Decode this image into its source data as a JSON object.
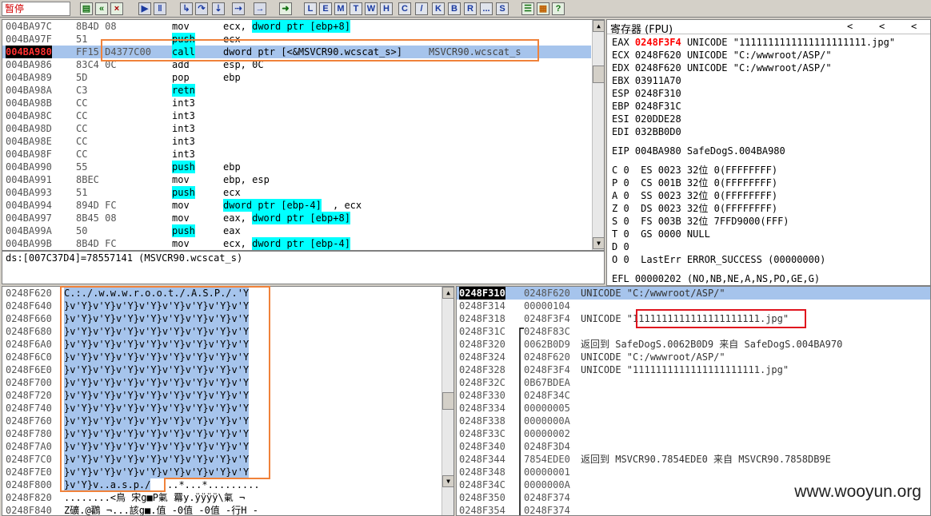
{
  "status": "暂停",
  "toolbar": {
    "buttons": [
      "open-icon",
      "rewind-icon",
      "close-icon",
      "play-icon",
      "pause-icon",
      "step-into-icon",
      "step-over-icon",
      "trace-into-icon",
      "trace-over-icon",
      "execute-till-return-icon",
      "goto-icon"
    ],
    "letters": [
      "L",
      "E",
      "M",
      "T",
      "W",
      "H",
      "C",
      "/",
      "K",
      "B",
      "R",
      "...",
      "S"
    ],
    "tail_buttons": [
      "list-icon",
      "grid-icon",
      "help-icon"
    ]
  },
  "disasm": {
    "rows": [
      {
        "addr": "004BA97C",
        "hex": "8B4D 08",
        "mn": "mov",
        "op": "ecx, ",
        "opc": "dword ptr [ebp+8]",
        "cm": ""
      },
      {
        "addr": "004BA97F",
        "hex": "51",
        "mn": "push",
        "op": "ecx",
        "opc": "",
        "cm": ""
      },
      {
        "addr": "004BA980",
        "hex": "FF15 D4377C00",
        "mn": "call",
        "op": "dword ptr [<&MSVCR90.wcscat_s>]",
        "opc": "",
        "cm": "MSVCR90.wcscat_s"
      },
      {
        "addr": "004BA986",
        "hex": "83C4 0C",
        "mn": "add",
        "op": "esp, 0C",
        "opc": "",
        "cm": ""
      },
      {
        "addr": "004BA989",
        "hex": "5D",
        "mn": "pop",
        "op": "ebp",
        "opc": "",
        "cm": ""
      },
      {
        "addr": "004BA98A",
        "hex": "C3",
        "mn": "retn",
        "op": "",
        "opc": "",
        "cm": ""
      },
      {
        "addr": "004BA98B",
        "hex": "CC",
        "mn": "int3",
        "op": "",
        "opc": "",
        "cm": ""
      },
      {
        "addr": "004BA98C",
        "hex": "CC",
        "mn": "int3",
        "op": "",
        "opc": "",
        "cm": ""
      },
      {
        "addr": "004BA98D",
        "hex": "CC",
        "mn": "int3",
        "op": "",
        "opc": "",
        "cm": ""
      },
      {
        "addr": "004BA98E",
        "hex": "CC",
        "mn": "int3",
        "op": "",
        "opc": "",
        "cm": ""
      },
      {
        "addr": "004BA98F",
        "hex": "CC",
        "mn": "int3",
        "op": "",
        "opc": "",
        "cm": ""
      },
      {
        "addr": "004BA990",
        "hex": "55",
        "mn": "push",
        "op": "ebp",
        "opc": "",
        "cm": ""
      },
      {
        "addr": "004BA991",
        "hex": "8BEC",
        "mn": "mov",
        "op": "ebp, esp",
        "opc": "",
        "cm": ""
      },
      {
        "addr": "004BA993",
        "hex": "51",
        "mn": "push",
        "op": "ecx",
        "opc": "",
        "cm": ""
      },
      {
        "addr": "004BA994",
        "hex": "894D FC",
        "mn": "mov",
        "op": ", ecx",
        "opc": "dword ptr [ebp-4]",
        "cm": "",
        "pre": true
      },
      {
        "addr": "004BA997",
        "hex": "8B45 08",
        "mn": "mov",
        "op": "eax, ",
        "opc": "dword ptr [ebp+8]",
        "cm": ""
      },
      {
        "addr": "004BA99A",
        "hex": "50",
        "mn": "push",
        "op": "eax",
        "opc": "",
        "cm": ""
      },
      {
        "addr": "004BA99B",
        "hex": "8B4D FC",
        "mn": "mov",
        "op": "ecx, ",
        "opc": "dword ptr [ebp-4]",
        "cm": ""
      }
    ],
    "info": "ds:[007C37D4]=78557141 (MSVCR90.wcscat_s)"
  },
  "registers": {
    "title": "寄存器 (FPU)",
    "nav": [
      "<",
      "<",
      "<"
    ],
    "gp": [
      {
        "name": "EAX",
        "val": "0248F3F4",
        "desc": "UNICODE \"1111111111111111111111.jpg\"",
        "hl": true
      },
      {
        "name": "ECX",
        "val": "0248F620",
        "desc": "UNICODE \"C:/wwwroot/ASP/\""
      },
      {
        "name": "EDX",
        "val": "0248F620",
        "desc": "UNICODE \"C:/wwwroot/ASP/\""
      },
      {
        "name": "EBX",
        "val": "03911A70",
        "desc": ""
      },
      {
        "name": "ESP",
        "val": "0248F310",
        "desc": ""
      },
      {
        "name": "EBP",
        "val": "0248F31C",
        "desc": ""
      },
      {
        "name": "ESI",
        "val": "020DDE28",
        "desc": ""
      },
      {
        "name": "EDI",
        "val": "032BB0D0",
        "desc": ""
      }
    ],
    "eip": "EIP 004BA980 SafeDogS.004BA980",
    "flags": [
      "C 0  ES 0023 32位 0(FFFFFFFF)",
      "P 0  CS 001B 32位 0(FFFFFFFF)",
      "A 0  SS 0023 32位 0(FFFFFFFF)",
      "Z 0  DS 0023 32位 0(FFFFFFFF)",
      "S 0  FS 003B 32位 7FFD9000(FFF)",
      "T 0  GS 0000 NULL",
      "D 0",
      "O 0  LastErr ERROR_SUCCESS (00000000)"
    ],
    "efl": "EFL 00000202 (NO,NB,NE,A,NS,PO,GE,G)"
  },
  "dump": {
    "rows": [
      {
        "addr": "0248F620",
        "text": "C.:./.w.w.w.r.o.o.t./.A.S.P./.'Y"
      },
      {
        "addr": "0248F640",
        "text": "}v'Y}v'Y}v'Y}v'Y}v'Y}v'Y}v'Y}v'Y"
      },
      {
        "addr": "0248F660",
        "text": "}v'Y}v'Y}v'Y}v'Y}v'Y}v'Y}v'Y}v'Y"
      },
      {
        "addr": "0248F680",
        "text": "}v'Y}v'Y}v'Y}v'Y}v'Y}v'Y}v'Y}v'Y"
      },
      {
        "addr": "0248F6A0",
        "text": "}v'Y}v'Y}v'Y}v'Y}v'Y}v'Y}v'Y}v'Y"
      },
      {
        "addr": "0248F6C0",
        "text": "}v'Y}v'Y}v'Y}v'Y}v'Y}v'Y}v'Y}v'Y"
      },
      {
        "addr": "0248F6E0",
        "text": "}v'Y}v'Y}v'Y}v'Y}v'Y}v'Y}v'Y}v'Y"
      },
      {
        "addr": "0248F700",
        "text": "}v'Y}v'Y}v'Y}v'Y}v'Y}v'Y}v'Y}v'Y"
      },
      {
        "addr": "0248F720",
        "text": "}v'Y}v'Y}v'Y}v'Y}v'Y}v'Y}v'Y}v'Y"
      },
      {
        "addr": "0248F740",
        "text": "}v'Y}v'Y}v'Y}v'Y}v'Y}v'Y}v'Y}v'Y"
      },
      {
        "addr": "0248F760",
        "text": "}v'Y}v'Y}v'Y}v'Y}v'Y}v'Y}v'Y}v'Y"
      },
      {
        "addr": "0248F780",
        "text": "}v'Y}v'Y}v'Y}v'Y}v'Y}v'Y}v'Y}v'Y"
      },
      {
        "addr": "0248F7A0",
        "text": "}v'Y}v'Y}v'Y}v'Y}v'Y}v'Y}v'Y}v'Y"
      },
      {
        "addr": "0248F7C0",
        "text": "}v'Y}v'Y}v'Y}v'Y}v'Y}v'Y}v'Y}v'Y"
      },
      {
        "addr": "0248F7E0",
        "text": "}v'Y}v'Y}v'Y}v'Y}v'Y}v'Y}v'Y}v'Y"
      },
      {
        "addr": "0248F800",
        "text": "}v'Y}v..a.s.p./",
        "text2": "..*...*........."
      },
      {
        "addr": "0248F820",
        "text": "........<鳥 宋g■P氭 羃y.ÿÿÿÿ\\氭 ¬"
      },
      {
        "addr": "0248F840",
        "text": "Z礦.@鸐 ¬...該g■.值 -0值 -0值 -行H -"
      }
    ]
  },
  "stack": {
    "rows": [
      {
        "addr": "0248F310",
        "val": "0248F620",
        "desc": "UNICODE \"C:/wwwroot/ASP/\"",
        "cur": true
      },
      {
        "addr": "0248F314",
        "val": "00000104",
        "desc": ""
      },
      {
        "addr": "0248F318",
        "val": "0248F3F4",
        "desc": "UNICODE \"1111111111111111111111.jpg\""
      },
      {
        "addr": "0248F31C",
        "val": "0248F83C",
        "desc": ""
      },
      {
        "addr": "0248F320",
        "val": "0062B0D9",
        "desc": "返回到 SafeDogS.0062B0D9 来自 SafeDogS.004BA970"
      },
      {
        "addr": "0248F324",
        "val": "0248F620",
        "desc": "UNICODE \"C:/wwwroot/ASP/\""
      },
      {
        "addr": "0248F328",
        "val": "0248F3F4",
        "desc": "UNICODE \"1111111111111111111111.jpg\""
      },
      {
        "addr": "0248F32C",
        "val": "0B67BDEA",
        "desc": ""
      },
      {
        "addr": "0248F330",
        "val": "0248F34C",
        "desc": ""
      },
      {
        "addr": "0248F334",
        "val": "00000005",
        "desc": ""
      },
      {
        "addr": "0248F338",
        "val": "0000000A",
        "desc": ""
      },
      {
        "addr": "0248F33C",
        "val": "00000002",
        "desc": ""
      },
      {
        "addr": "0248F340",
        "val": "0248F3D4",
        "desc": ""
      },
      {
        "addr": "0248F344",
        "val": "7854EDE0",
        "desc": "返回到 MSVCR90.7854EDE0 来自 MSVCR90.7858DB9E"
      },
      {
        "addr": "0248F348",
        "val": "00000001",
        "desc": ""
      },
      {
        "addr": "0248F34C",
        "val": "0000000A",
        "desc": ""
      },
      {
        "addr": "0248F350",
        "val": "0248F374",
        "desc": ""
      },
      {
        "addr": "0248F354",
        "val": "0248F374",
        "desc": ""
      }
    ]
  },
  "watermark": "www.wooyun.org",
  "colors": {
    "highlight": "#a6c4ec",
    "cyan": "#00ffff",
    "orange": "#f0823a",
    "red": "#e0141e",
    "regred": "#ff0000"
  }
}
